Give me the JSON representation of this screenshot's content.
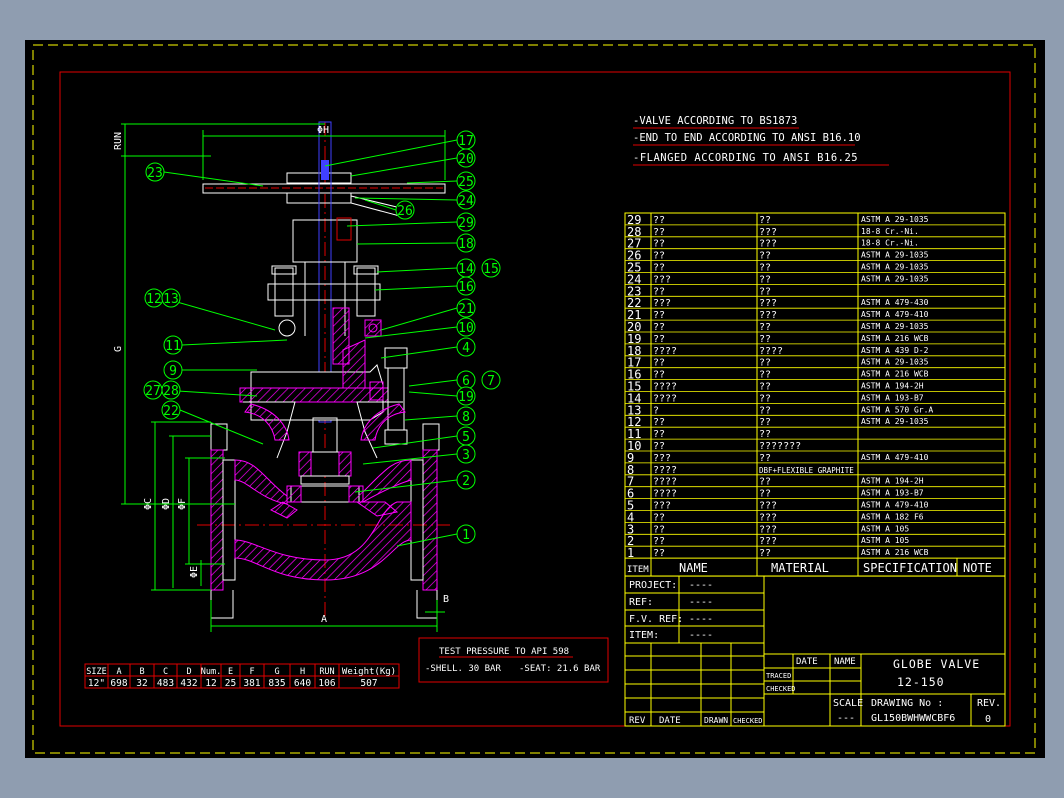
{
  "notes": [
    "-VALVE ACCORDING TO BS1873",
    "-END TO END ACCORDING TO ANSI B16.10",
    "-FLANGED ACCORDING TO ANSI B16.25"
  ],
  "dims": {
    "run": "RUN",
    "h": "ΦH",
    "g": "G",
    "c": "ΦC",
    "d": "ΦD",
    "f": "ΦF",
    "e": "ΦE",
    "a": "A",
    "b": "B"
  },
  "balloons": [
    "17",
    "20",
    "25",
    "24",
    "26",
    "29",
    "18",
    "14",
    "15",
    "16",
    "21",
    "10",
    "4",
    "6",
    "7",
    "19",
    "8",
    "5",
    "3",
    "2",
    "1",
    "23",
    "12",
    "13",
    "11",
    "9",
    "27",
    "28",
    "22"
  ],
  "bom": [
    {
      "item": "29",
      "name": "??",
      "material": "??",
      "spec": "ASTM A 29-1035"
    },
    {
      "item": "28",
      "name": "??",
      "material": "???",
      "spec": "18-8 Cr.-Ni."
    },
    {
      "item": "27",
      "name": "??",
      "material": "???",
      "spec": "18-8 Cr.-Ni."
    },
    {
      "item": "26",
      "name": "??",
      "material": "??",
      "spec": "ASTM A 29-1035"
    },
    {
      "item": "25",
      "name": "??",
      "material": "??",
      "spec": "ASTM A 29-1035"
    },
    {
      "item": "24",
      "name": "???",
      "material": "??",
      "spec": "ASTM A 29-1035"
    },
    {
      "item": "23",
      "name": "??",
      "material": "??",
      "spec": ""
    },
    {
      "item": "22",
      "name": "???",
      "material": "???",
      "spec": "ASTM A 479-430"
    },
    {
      "item": "21",
      "name": "??",
      "material": "???",
      "spec": "ASTM A 479-410"
    },
    {
      "item": "20",
      "name": "??",
      "material": "??",
      "spec": "ASTM A 29-1035"
    },
    {
      "item": "19",
      "name": "??",
      "material": "??",
      "spec": "ASTM A 216 WCB"
    },
    {
      "item": "18",
      "name": "????",
      "material": "????",
      "spec": "ASTM A 439 D-2"
    },
    {
      "item": "17",
      "name": "??",
      "material": "??",
      "spec": "ASTM A 29-1035"
    },
    {
      "item": "16",
      "name": "??",
      "material": "??",
      "spec": "ASTM A 216 WCB"
    },
    {
      "item": "15",
      "name": "????",
      "material": "??",
      "spec": "ASTM A 194-2H"
    },
    {
      "item": "14",
      "name": "????",
      "material": "??",
      "spec": "ASTM A 193-B7"
    },
    {
      "item": "13",
      "name": "?",
      "material": "??",
      "spec": "ASTM A 570 Gr.A"
    },
    {
      "item": "12",
      "name": "??",
      "material": "??",
      "spec": "ASTM A 29-1035"
    },
    {
      "item": "11",
      "name": "??",
      "material": "??",
      "spec": ""
    },
    {
      "item": "10",
      "name": "??",
      "material": "???????",
      "spec": ""
    },
    {
      "item": "9",
      "name": "???",
      "material": "??",
      "spec": "ASTM A 479-410"
    },
    {
      "item": "8",
      "name": "????",
      "material": "DBF+FLEXIBLE GRAPHITE",
      "spec": ""
    },
    {
      "item": "7",
      "name": "????",
      "material": "??",
      "spec": "ASTM A 194-2H"
    },
    {
      "item": "6",
      "name": "????",
      "material": "??",
      "spec": "ASTM A 193-B7"
    },
    {
      "item": "5",
      "name": "???",
      "material": "???",
      "spec": "ASTM A 479-410"
    },
    {
      "item": "4",
      "name": "??",
      "material": "???",
      "spec": "ASTM A 182 F6"
    },
    {
      "item": "3",
      "name": "??",
      "material": "???",
      "spec": "ASTM A 105"
    },
    {
      "item": "2",
      "name": "??",
      "material": "???",
      "spec": "ASTM A 105"
    },
    {
      "item": "1",
      "name": "??",
      "material": "??",
      "spec": "ASTM A 216 WCB"
    }
  ],
  "bom_header": {
    "item": "ITEM",
    "name": "NAME",
    "material": "MATERIAL",
    "spec": "SPECIFICATION",
    "note": "NOTE"
  },
  "info": {
    "project": "PROJECT:",
    "ref": "REF:",
    "fv_ref": "F.V. REF:",
    "item": "ITEM:",
    "blank": "----"
  },
  "title_block": {
    "date": "DATE",
    "name": "NAME",
    "traced": "TRACED",
    "checked": "CHECKED",
    "title": "GLOBE VALVE",
    "rating": "12-150",
    "scale": "SCALE",
    "scale_value": "---",
    "drawing_no_label": "DRAWING No :",
    "drawing_no": "GL150BWHWWCBF6",
    "rev_label": "REV.",
    "rev": "0"
  },
  "rev_block": {
    "rev": "REV",
    "date": "DATE",
    "drawn": "DRAWN",
    "checked": "CHECKED"
  },
  "test": {
    "title": "TEST PRESSURE TO API 598",
    "shell": "-SHELL. 30 BAR",
    "seat": "-SEAT: 21.6 BAR"
  },
  "size_table": {
    "headers": [
      "SIZE",
      "A",
      "B",
      "C",
      "D",
      "Num.",
      "E",
      "F",
      "G",
      "H",
      "RUN",
      "Weight(Kg)"
    ],
    "row": [
      "12\"",
      "698",
      "32",
      "483",
      "432",
      "12",
      "25",
      "381",
      "835",
      "640",
      "106",
      "507"
    ]
  },
  "colors": {
    "sheet": "#000000",
    "frame": "#e00000",
    "part": "#00ff00",
    "table": "#ffff00",
    "text": "#ffffff",
    "hatch": "#ff00ff",
    "stem": "#4040ff"
  }
}
